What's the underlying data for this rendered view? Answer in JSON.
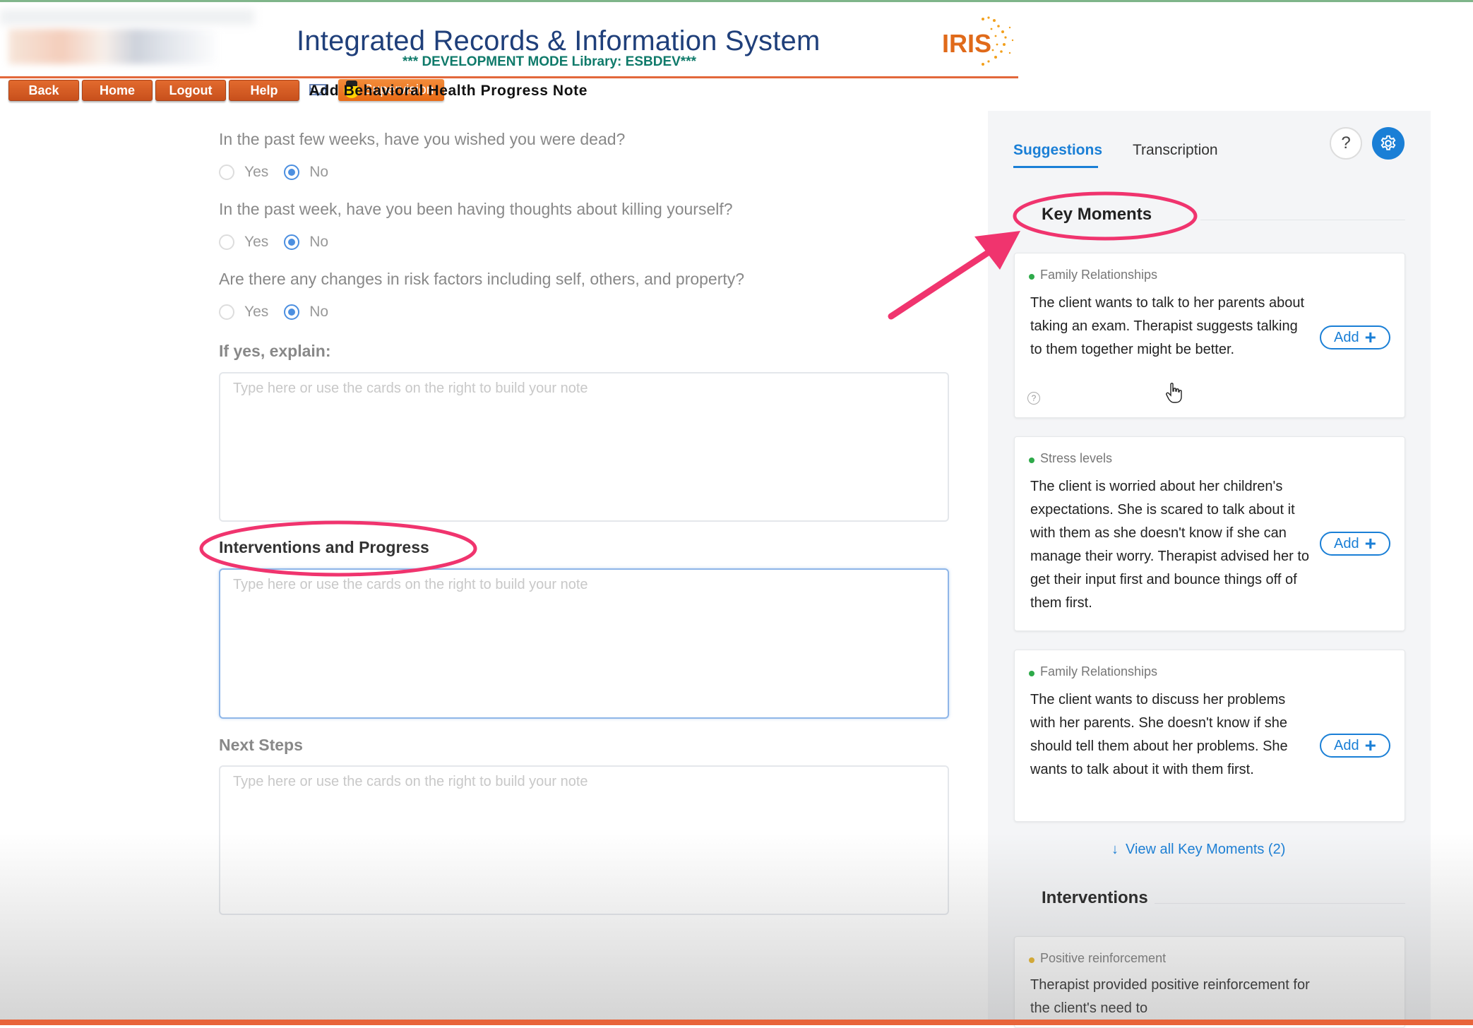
{
  "header": {
    "title": "Integrated Records & Information System",
    "dev_mode": "*** DEVELOPMENT MODE Library: ESBDEV***",
    "logo_text": "IRIS"
  },
  "nav": {
    "back": "Back",
    "home": "Home",
    "logout": "Logout",
    "help": "Help",
    "mail_icon": "mail-icon",
    "supervision": "Supervision",
    "page_heading": "Add Behavioral Health Progress Note"
  },
  "form": {
    "questions": [
      {
        "text": "In the past few weeks, have you wished you were dead?",
        "yes": "Yes",
        "no": "No",
        "selected": "No"
      },
      {
        "text": "In the past week, have you been having thoughts about killing yourself?",
        "yes": "Yes",
        "no": "No",
        "selected": "No"
      },
      {
        "text": "Are there any changes in risk factors including self, others, and property?",
        "yes": "Yes",
        "no": "No",
        "selected": "No"
      }
    ],
    "if_yes_label": "If yes, explain:",
    "interventions_label": "Interventions and Progress",
    "next_steps_label": "Next Steps",
    "placeholder": "Type here or use the cards on the right to build your note"
  },
  "sidebar": {
    "tabs": [
      {
        "label": "Suggestions",
        "active": true
      },
      {
        "label": "Transcription",
        "active": false
      }
    ],
    "help_icon": "question-icon",
    "settings_icon": "gear-icon",
    "key_moments_title": "Key Moments",
    "cards": [
      {
        "category": "Family Relationships",
        "text": "The client wants to talk to her parents about taking an exam. Therapist suggests talking to them together might be better.",
        "add": "Add"
      },
      {
        "category": "Stress levels",
        "text": "The client is worried about her children's expectations. She is scared to talk about it with them as she doesn't know if she can manage their worry. Therapist advised her to get their input first and bounce things off of them first.",
        "add": "Add"
      },
      {
        "category": "Family Relationships",
        "text": "The client wants to discuss her problems with her parents. She doesn't know if she should tell them about her problems. She wants to talk about it with them first.",
        "add": "Add"
      }
    ],
    "view_all": "View all Key Moments (2)",
    "interventions_title": "Interventions",
    "intervention_cards": [
      {
        "category": "Positive reinforcement",
        "text": "Therapist provided positive reinforcement for the client's need to"
      }
    ]
  },
  "colors": {
    "accent": "#1a7fd6",
    "nav_button": "#d95a22",
    "annotation": "#f0346e",
    "title": "#1f3f7a"
  }
}
